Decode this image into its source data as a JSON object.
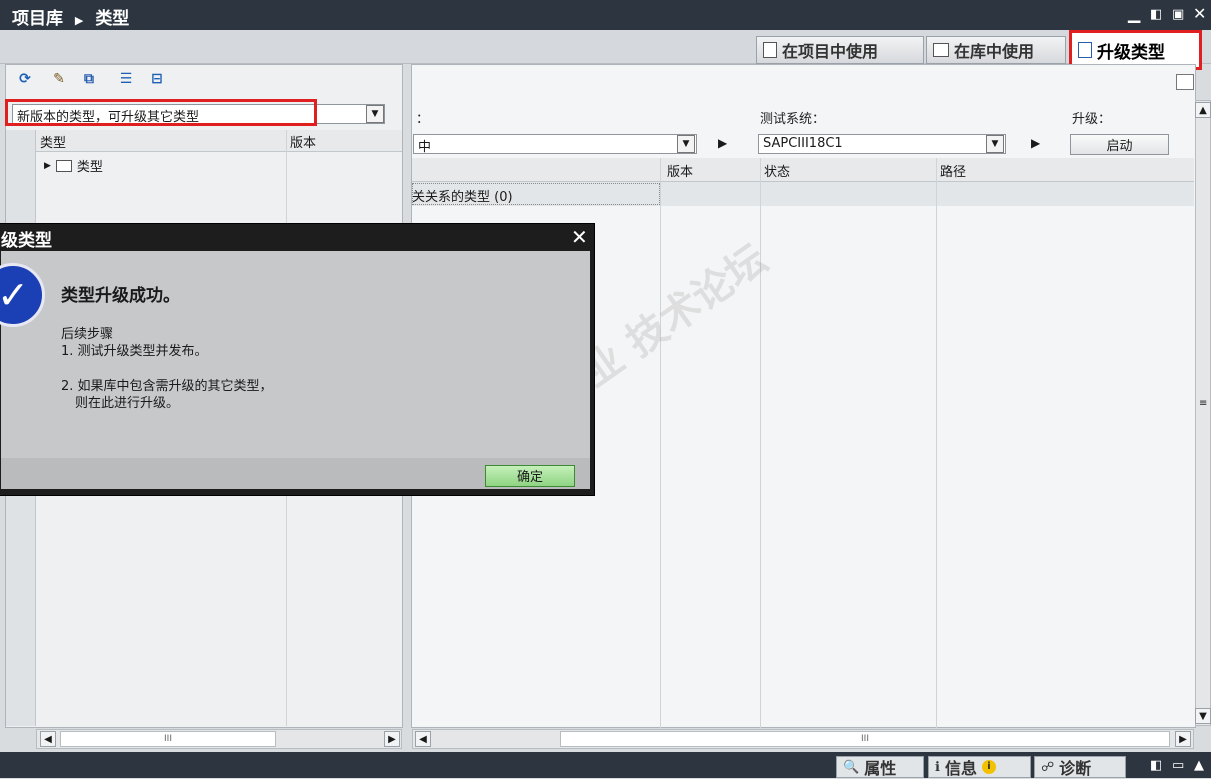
{
  "title_bar": {
    "breadcrumb_root": "项目库",
    "breadcrumb_current": "类型"
  },
  "tabs": [
    {
      "label": "在项目中使用",
      "icon": "document-icon"
    },
    {
      "label": "在库中使用",
      "icon": "library-icon"
    },
    {
      "label": "升级类型",
      "icon": "upgrade-icon",
      "active": true
    }
  ],
  "left": {
    "filter_value": "新版本的类型，可升级其它类型",
    "col_type": "类型",
    "col_version": "版本",
    "tree_item": "类型"
  },
  "right": {
    "label_colon": "：",
    "test_system_label": "测试系统：",
    "upgrade_label": "升级：",
    "left_select_value": "中",
    "test_system_value": "SAPCIII18C1",
    "start_button": "启动",
    "col_version": "版本",
    "col_status": "状态",
    "col_path": "路径",
    "row_text": "关关系的类型 (0)"
  },
  "dialog": {
    "title": "级类型",
    "message": "类型升级成功。",
    "next_steps_title": "后续步骤",
    "step1": "1. 测试升级类型并发布。",
    "step2": "2. 如果库中包含需升级的其它类型，",
    "step2b": "则在此进行升级。",
    "ok_button": "确定"
  },
  "bottom": {
    "tabs": [
      {
        "label": "属性",
        "icon": "properties-icon"
      },
      {
        "label": "信息",
        "icon": "info-icon"
      },
      {
        "label": "诊断",
        "icon": "diagnostics-icon"
      }
    ]
  },
  "scrollbar_grip": "III",
  "colors": {
    "title_bar": "#2d3640",
    "highlight_box": "#e02020",
    "ok_button": "#8fd483",
    "check_circle": "#1b3fb5"
  }
}
